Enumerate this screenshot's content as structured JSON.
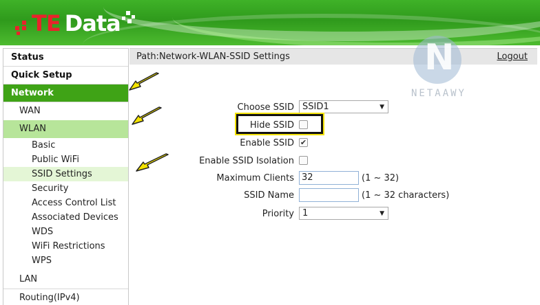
{
  "header": {
    "logo_te": "TE",
    "logo_data": "Data"
  },
  "sidebar": {
    "items": [
      {
        "label": "Status",
        "level": 1,
        "active": false
      },
      {
        "label": "Quick Setup",
        "level": 1,
        "active": false
      },
      {
        "label": "Network",
        "level": 1,
        "active": true
      },
      {
        "label": "WAN",
        "level": 2,
        "active": false
      },
      {
        "label": "WLAN",
        "level": 2,
        "active": true
      },
      {
        "label": "Basic",
        "level": 3,
        "active": false
      },
      {
        "label": "Public WiFi",
        "level": 3,
        "active": false
      },
      {
        "label": "SSID Settings",
        "level": 3,
        "active": true
      },
      {
        "label": "Security",
        "level": 3,
        "active": false
      },
      {
        "label": "Access Control List",
        "level": 3,
        "active": false
      },
      {
        "label": "Associated Devices",
        "level": 3,
        "active": false
      },
      {
        "label": "WDS",
        "level": 3,
        "active": false
      },
      {
        "label": "WiFi Restrictions",
        "level": 3,
        "active": false
      },
      {
        "label": "WPS",
        "level": 3,
        "active": false
      },
      {
        "label": "LAN",
        "level": 2,
        "active": false
      },
      {
        "label": "Routing(IPv4)",
        "level": 2,
        "active": false
      }
    ]
  },
  "pathbar": {
    "path": "Path:Network-WLAN-SSID Settings",
    "logout": "Logout"
  },
  "watermark": {
    "letter": "N",
    "text": "NETAAWY"
  },
  "form": {
    "choose_ssid": {
      "label": "Choose SSID",
      "value": "SSID1"
    },
    "hide_ssid": {
      "label": "Hide SSID",
      "checked": false
    },
    "enable_ssid": {
      "label": "Enable SSID",
      "checked": true
    },
    "enable_isolation": {
      "label": "Enable SSID Isolation",
      "checked": false
    },
    "max_clients": {
      "label": "Maximum Clients",
      "value": "32",
      "hint": "(1 ~ 32)"
    },
    "ssid_name": {
      "label": "SSID Name",
      "value": "",
      "hint": "(1 ~ 32 characters)"
    },
    "priority": {
      "label": "Priority",
      "value": "1"
    }
  },
  "colors": {
    "header_green": "#3fb228",
    "active_nav": "#3fa316",
    "active_sub": "#b7e59a",
    "active_subsub": "#e4f6d6",
    "annotation_yellow": "#f4e300"
  },
  "icons": {
    "dropdown": "chevron-down-icon",
    "checkmark": "check-icon",
    "annotation_arrow": "arrow-icon"
  }
}
